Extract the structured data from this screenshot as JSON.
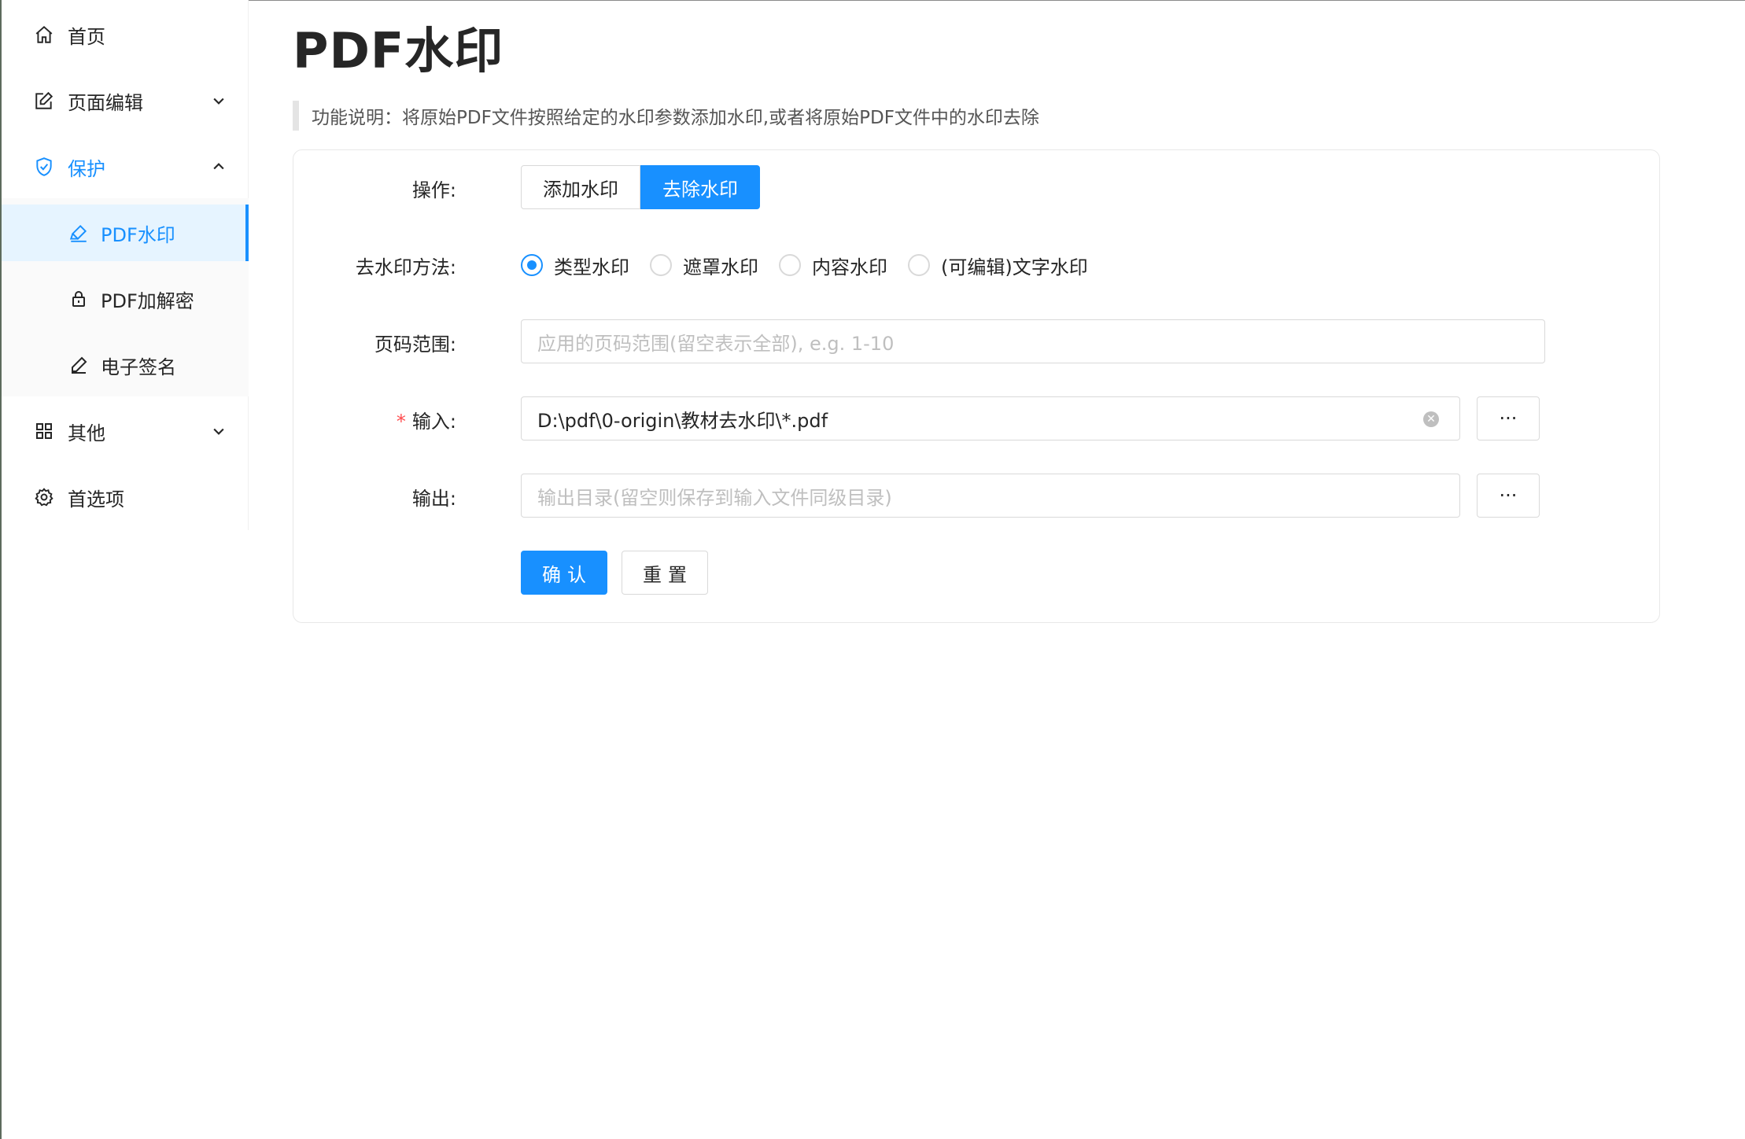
{
  "sidebar": {
    "items": [
      {
        "label": "首页",
        "icon": "home-icon"
      },
      {
        "label": "页面编辑",
        "icon": "edit-icon"
      },
      {
        "label": "保护",
        "icon": "shield-icon"
      },
      {
        "label": "其他",
        "icon": "grid-icon"
      },
      {
        "label": "首选项",
        "icon": "gear-icon"
      }
    ],
    "protect_sub": [
      {
        "label": "PDF水印",
        "icon": "highlighter-icon",
        "selected": true
      },
      {
        "label": "PDF加解密",
        "icon": "lock-icon"
      },
      {
        "label": "电子签名",
        "icon": "pen-icon"
      }
    ]
  },
  "main": {
    "title": "PDF水印",
    "description": "功能说明：将原始PDF文件按照给定的水印参数添加水印,或者将原始PDF文件中的水印去除"
  },
  "form": {
    "operation": {
      "label": "操作:",
      "options": [
        "添加水印",
        "去除水印"
      ],
      "selected": "去除水印"
    },
    "method": {
      "label": "去水印方法:",
      "options": [
        "类型水印",
        "遮罩水印",
        "内容水印",
        "(可编辑)文字水印"
      ],
      "selected": "类型水印"
    },
    "page_range": {
      "label": "页码范围:",
      "placeholder": "应用的页码范围(留空表示全部), e.g. 1-10",
      "value": ""
    },
    "input": {
      "required_mark": "*",
      "label": "输入:",
      "value": "D:\\pdf\\0-origin\\教材去水印\\*.pdf",
      "browse_label": "···"
    },
    "output": {
      "label": "输出:",
      "placeholder": "输出目录(留空则保存到输入文件同级目录)",
      "value": "",
      "browse_label": "···"
    },
    "confirm_label": "确认",
    "reset_label": "重置"
  },
  "colors": {
    "accent": "#1890ff",
    "required": "#ff4d4f",
    "border": "#d9d9d9"
  }
}
